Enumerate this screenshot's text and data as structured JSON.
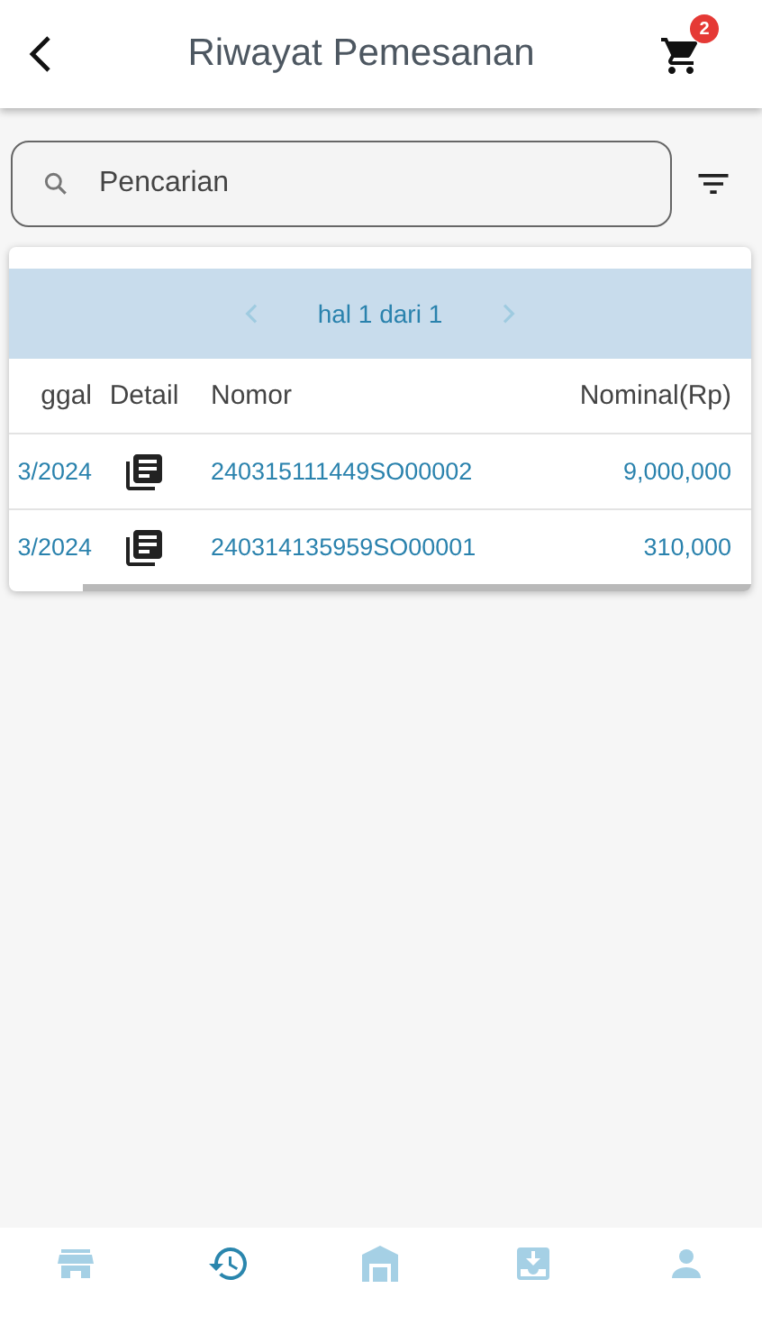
{
  "header": {
    "title": "Riwayat Pemesanan",
    "cart_badge": "2"
  },
  "search": {
    "placeholder": "Pencarian"
  },
  "pagination": {
    "label": "hal 1 dari 1",
    "prev_disabled": true,
    "next_disabled": true
  },
  "table": {
    "columns": [
      "ggal",
      "Detail",
      "Nomor",
      "Nominal(Rp)"
    ],
    "rows": [
      {
        "date": "3/2024",
        "number": "240315111449SO00002",
        "amount": "9,000,000"
      },
      {
        "date": "3/2024",
        "number": "240314135959SO00001",
        "amount": "310,000"
      }
    ]
  },
  "nav": [
    {
      "kind": "store",
      "selected": false
    },
    {
      "kind": "history",
      "selected": true
    },
    {
      "kind": "warehouse",
      "selected": false
    },
    {
      "kind": "inbox",
      "selected": false
    },
    {
      "kind": "person",
      "selected": false
    }
  ]
}
